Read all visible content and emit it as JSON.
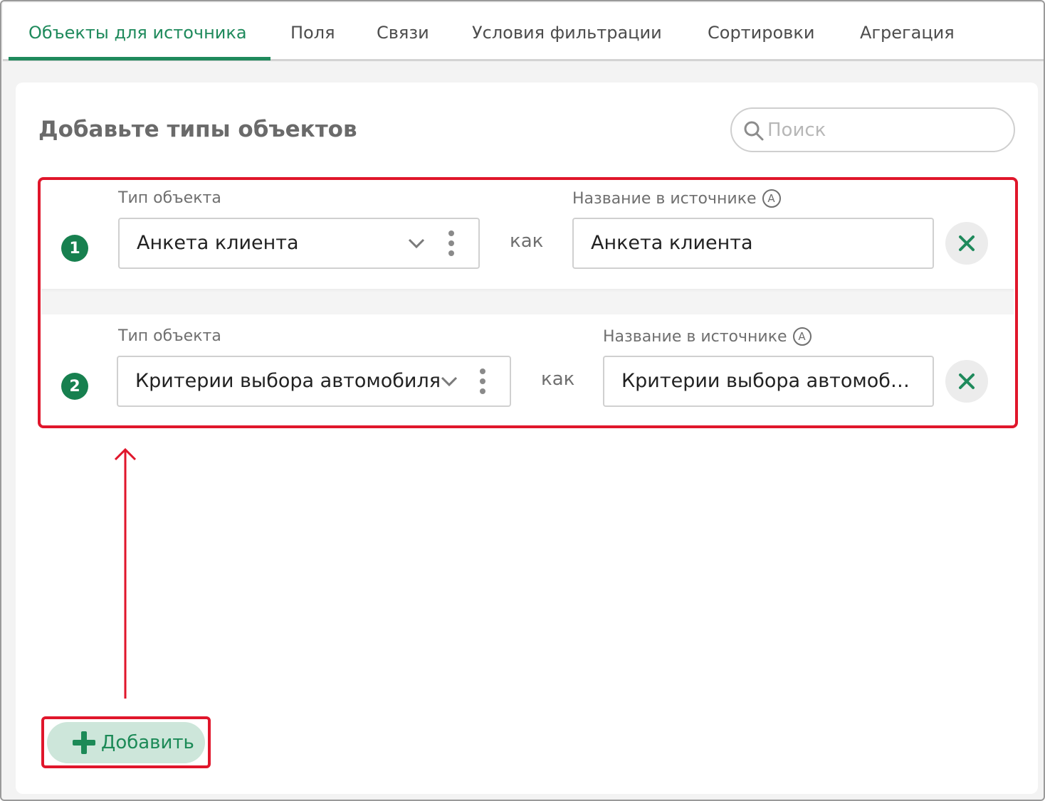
{
  "tabs": [
    {
      "label": "Объекты для источника",
      "active": true
    },
    {
      "label": "Поля",
      "active": false
    },
    {
      "label": "Связи",
      "active": false
    },
    {
      "label": "Условия фильтрации",
      "active": false
    },
    {
      "label": "Сортировки",
      "active": false
    },
    {
      "label": "Агрегация",
      "active": false
    }
  ],
  "panel": {
    "heading": "Добавьте типы объектов",
    "search_placeholder": "Поиск"
  },
  "rows": [
    {
      "number": "1",
      "type_label": "Тип объекта",
      "type_value": "Анкета клиента",
      "as_label": "как",
      "name_label": "Название в источнике",
      "name_value": "Анкета клиента"
    },
    {
      "number": "2",
      "type_label": "Тип объекта",
      "type_value": "Критерии выбора автомобиля",
      "as_label": "как",
      "name_label": "Название в источнике",
      "name_value": "Критерии выбора автомоб…"
    }
  ],
  "add_button": {
    "label": "Добавить"
  },
  "colors": {
    "accent": "#1f8a5c",
    "highlight": "#e0162b",
    "add_button_bg": "#cde6da"
  },
  "icons": {
    "search": "search-icon",
    "dropdown": "chevron-down-icon",
    "more": "kebab-menu-icon",
    "auto": "auto-name-icon",
    "remove": "close-icon",
    "add": "plus-icon",
    "annotation_arrow": "arrow-up-icon"
  }
}
